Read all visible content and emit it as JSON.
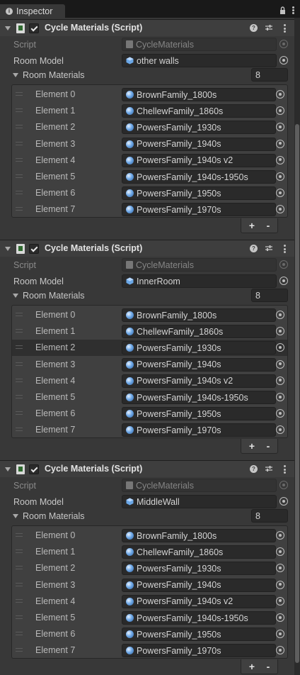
{
  "window": {
    "tab_label": "Inspector",
    "tab_icon": "info-icon",
    "lock_icon": "lock-icon",
    "menu_icon": "kebab-menu-icon"
  },
  "components": [
    {
      "title": "Cycle Materials (Script)",
      "enabled": true,
      "script_label": "Script",
      "script_value": "CycleMaterials",
      "room_model_label": "Room Model",
      "room_model_value": "other walls",
      "list_label": "Room Materials",
      "list_size": "8",
      "selected_index": -1,
      "elements": [
        {
          "label": "Element 0",
          "value": "BrownFamily_1800s"
        },
        {
          "label": "Element 1",
          "value": "ChellewFamily_1860s"
        },
        {
          "label": "Element 2",
          "value": "PowersFamily_1930s"
        },
        {
          "label": "Element 3",
          "value": "PowersFamily_1940s"
        },
        {
          "label": "Element 4",
          "value": "PowersFamily_1940s v2"
        },
        {
          "label": "Element 5",
          "value": "PowersFamily_1940s-1950s"
        },
        {
          "label": "Element 6",
          "value": "PowersFamily_1950s"
        },
        {
          "label": "Element 7",
          "value": "PowersFamily_1970s"
        }
      ],
      "add_label": "+",
      "remove_label": "-"
    },
    {
      "title": "Cycle Materials (Script)",
      "enabled": true,
      "script_label": "Script",
      "script_value": "CycleMaterials",
      "room_model_label": "Room Model",
      "room_model_value": "InnerRoom",
      "list_label": "Room Materials",
      "list_size": "8",
      "selected_index": 2,
      "elements": [
        {
          "label": "Element 0",
          "value": "BrownFamily_1800s"
        },
        {
          "label": "Element 1",
          "value": "ChellewFamily_1860s"
        },
        {
          "label": "Element 2",
          "value": "PowersFamily_1930s"
        },
        {
          "label": "Element 3",
          "value": "PowersFamily_1940s"
        },
        {
          "label": "Element 4",
          "value": "PowersFamily_1940s v2"
        },
        {
          "label": "Element 5",
          "value": "PowersFamily_1940s-1950s"
        },
        {
          "label": "Element 6",
          "value": "PowersFamily_1950s"
        },
        {
          "label": "Element 7",
          "value": "PowersFamily_1970s"
        }
      ],
      "add_label": "+",
      "remove_label": "-"
    },
    {
      "title": "Cycle Materials (Script)",
      "enabled": true,
      "script_label": "Script",
      "script_value": "CycleMaterials",
      "room_model_label": "Room Model",
      "room_model_value": "MiddleWall",
      "list_label": "Room Materials",
      "list_size": "8",
      "selected_index": -1,
      "elements": [
        {
          "label": "Element 0",
          "value": "BrownFamily_1800s"
        },
        {
          "label": "Element 1",
          "value": "ChellewFamily_1860s"
        },
        {
          "label": "Element 2",
          "value": "PowersFamily_1930s"
        },
        {
          "label": "Element 3",
          "value": "PowersFamily_1940s"
        },
        {
          "label": "Element 4",
          "value": "PowersFamily_1940s v2"
        },
        {
          "label": "Element 5",
          "value": "PowersFamily_1940s-1950s"
        },
        {
          "label": "Element 6",
          "value": "PowersFamily_1950s"
        },
        {
          "label": "Element 7",
          "value": "PowersFamily_1970s"
        }
      ],
      "add_label": "+",
      "remove_label": "-"
    }
  ],
  "icons": {
    "component_fold": "fold-arrow-icon",
    "script": "script-icon",
    "enable": "checkbox-icon",
    "help": "help-icon",
    "presets": "presets-icon",
    "menu": "kebab-menu-icon",
    "game_object": "gameobject-icon",
    "material": "material-ball-icon",
    "object_picker": "object-picker-icon",
    "drag_handle": "drag-handle-icon"
  },
  "colors": {
    "panel_bg": "#383838",
    "header_bg": "#3e3e3e",
    "field_bg": "#2a2a2a",
    "selected_row": "#2f2f2f",
    "text": "#c8c8c8"
  }
}
